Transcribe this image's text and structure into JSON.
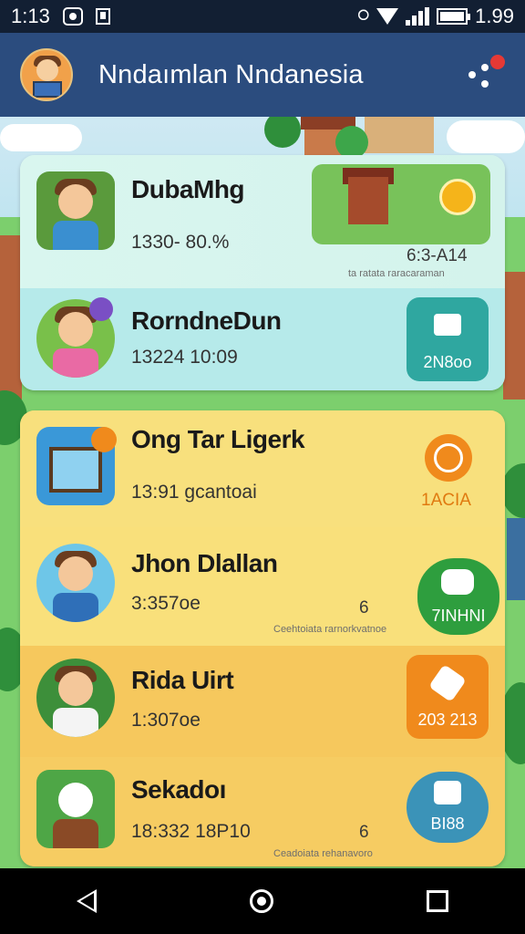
{
  "status_bar": {
    "time": "1:13",
    "battery": "1.99"
  },
  "appbar": {
    "title": "Nndaımlan Nndanesia"
  },
  "list": {
    "group1": [
      {
        "name": "DubaMhg",
        "subtitle": "1330- 80.%",
        "right_value": "6:3-A14",
        "right_meta": "ta ratata raracaraman"
      },
      {
        "name": "RorndneDun",
        "subtitle": "13224 10:09",
        "tile_label": "2N8oo"
      }
    ],
    "group2": [
      {
        "name": "Ong Tar Ligerk",
        "subtitle": "13:91 gcantoai",
        "tile_label": "1ACIA"
      },
      {
        "name": "Jhon Dlallan",
        "subtitle": "3:357oe",
        "count": "6",
        "meta": "Ceehtoiata rarnorkvatnoe",
        "tile_label": "7INHNI"
      },
      {
        "name": "Rida Uirt",
        "subtitle": "1:307oe",
        "tile_label": "203 213"
      },
      {
        "name": "Sekadoı",
        "subtitle": "18:332 18P10",
        "count": "6",
        "meta": "Ceadoiata rehanavoro",
        "tile_label": "BI88"
      }
    ]
  },
  "colors": {
    "status_bar_bg": "#121f33",
    "appbar_bg": "#2b4c7e",
    "card_blue": "#b6eaea",
    "card_yellow": "#f7df74",
    "tile_teal": "#2fa7a0",
    "tile_orange": "#f08a1c",
    "tile_green": "#2e9e3e",
    "tile_blue": "#3b93b8"
  }
}
